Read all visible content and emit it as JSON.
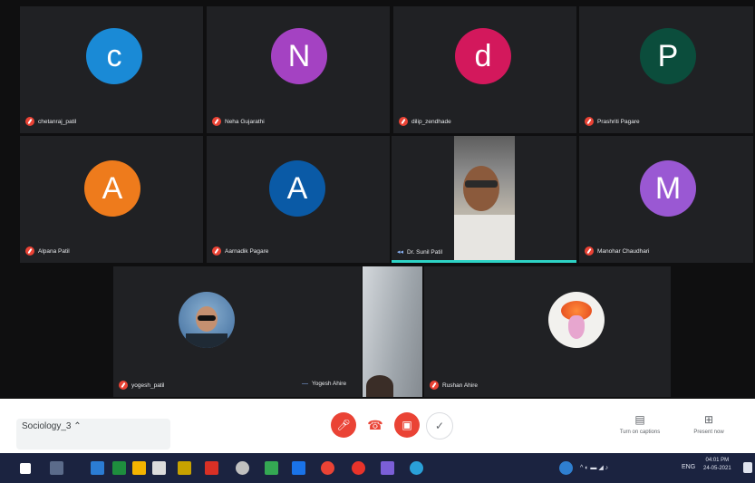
{
  "participants_row1": [
    {
      "initial": "c",
      "name": "chetanraj_patil",
      "color": "#1a8ad6"
    },
    {
      "initial": "N",
      "name": "Neha Gujarathi",
      "color": "#a442c2"
    },
    {
      "initial": "d",
      "name": "dilip_zendhade",
      "color": "#d3185c"
    },
    {
      "initial": "P",
      "name": "Prashriti Pagare",
      "color": "#0b4d3c"
    }
  ],
  "participants_row2": [
    {
      "initial": "A",
      "name": "Alpana Patil",
      "color": "#ee7b1c"
    },
    {
      "initial": "A",
      "name": "Aarnadik Pagare",
      "color": "#0a5aa6"
    },
    {
      "initial": "",
      "name": "Dr. Sunil Patil",
      "color": ""
    },
    {
      "initial": "M",
      "name": "Manohar Chaudhari",
      "color": "#9a58d3"
    }
  ],
  "participants_row3": [
    {
      "name": "yogesh_patil"
    },
    {
      "name": "Yogesh Ahire"
    },
    {
      "name": "Rushan Ahire"
    }
  ],
  "meeting": {
    "title": "Sociology_3"
  },
  "controls": {
    "captions": "Turn on captions",
    "present": "Present now"
  },
  "taskbar": {
    "time": "04:01 PM",
    "date": "24-05-2021",
    "lang": "ENG"
  },
  "icons": {
    "mic_off": "mic-off-icon",
    "hangup": "hangup-icon",
    "camera_off": "camera-off-icon",
    "raise_hand": "hand-icon",
    "captions": "captions-icon",
    "present": "present-icon"
  }
}
